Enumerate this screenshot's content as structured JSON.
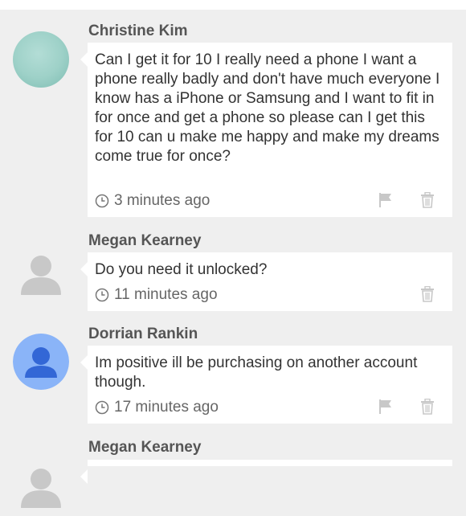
{
  "comments": [
    {
      "author": "Christine Kim",
      "text": "Can I get it for 10 I really need a phone I want a phone really badly and don't have much everyone I know has a iPhone or Samsung and I want to fit in for once and get a phone so please can I get this for 10 can u make me happy and make my dreams come true for once?",
      "time": "3 minutes ago",
      "avatar": "teal-photo",
      "has_flag": true
    },
    {
      "author": "Megan Kearney",
      "text": "Do you need it unlocked?",
      "time": "11 minutes ago",
      "avatar": "default-gray",
      "has_flag": false
    },
    {
      "author": "Dorrian Rankin",
      "text": "Im positive ill be purchasing on another account though.",
      "time": "17 minutes ago",
      "avatar": "default-blue",
      "has_flag": true
    },
    {
      "author": "Megan Kearney",
      "avatar": "default-gray"
    }
  ],
  "icons": {
    "clock": "clock-icon",
    "flag": "flag-icon",
    "trash": "trash-icon"
  },
  "colors": {
    "background": "#efefef",
    "bubble": "#ffffff",
    "author": "#555555",
    "icon": "#c8c8c8",
    "avatar_gray": "#c8c8c8",
    "avatar_blue_bg": "#8ab4f8",
    "avatar_blue_fg": "#3367d6"
  }
}
